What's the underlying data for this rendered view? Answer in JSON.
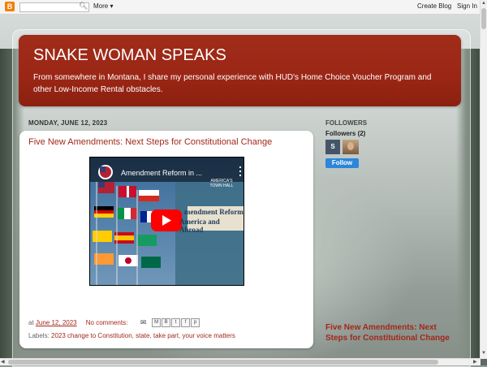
{
  "navbar": {
    "logo_letter": "B",
    "search_placeholder": "",
    "more_label": "More",
    "create_blog_label": "Create Blog",
    "sign_in_label": "Sign In"
  },
  "header": {
    "title": "SNAKE WOMAN SPEAKS",
    "description": "From somewhere in Montana, I share my personal experience with HUD's Home Choice Voucher Program and other Low-Income Rental obstacles."
  },
  "post": {
    "date": "MONDAY, JUNE 12, 2023",
    "title": "Five New Amendments: Next Steps for Constitutional Change",
    "video": {
      "title": "Amendment Reform in ...",
      "channel_badge": "AMERICA'S TOWN HALL",
      "overlay_text_line1": "mendment Reform",
      "overlay_text_line2": "America and Abroad"
    },
    "footer": {
      "at_label": "at",
      "time": "June 12, 2023",
      "comments": "No comments:"
    },
    "share_buttons": [
      "M",
      "B",
      "t",
      "f",
      "p"
    ],
    "labels_prefix": "Labels:",
    "labels": [
      "2023 change to Constitution",
      "state",
      "take part",
      "your voice matters"
    ]
  },
  "sidebar": {
    "followers_title": "FOLLOWERS",
    "followers_count": "Followers (2)",
    "avatar_letter": "S",
    "follow_label": "Follow",
    "popular_post_title": "Five New Amendments: Next Steps for Constitutional Change"
  },
  "colors": {
    "header_bg": "#9b2615",
    "link": "#a2281a",
    "follow_button": "#2c86d9"
  }
}
